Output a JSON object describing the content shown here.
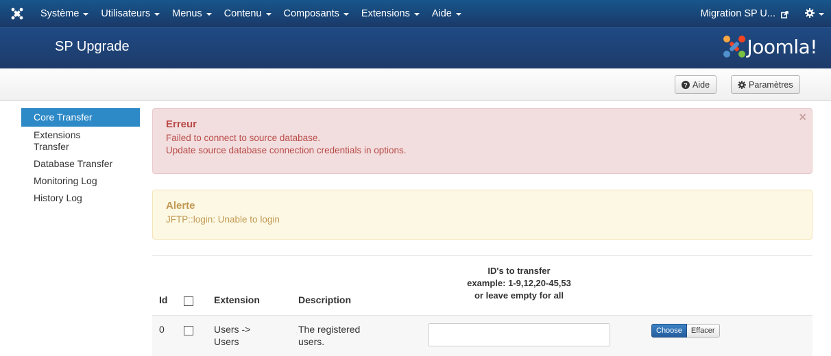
{
  "navbar": {
    "menus": [
      {
        "label": "Système"
      },
      {
        "label": "Utilisateurs"
      },
      {
        "label": "Menus"
      },
      {
        "label": "Contenu"
      },
      {
        "label": "Composants"
      },
      {
        "label": "Extensions"
      },
      {
        "label": "Aide"
      }
    ],
    "site_link": "Migration SP U..."
  },
  "header": {
    "title": "SP Upgrade",
    "brand": "Joomla!"
  },
  "toolbar": {
    "help_label": "Aide",
    "options_label": "Paramètres"
  },
  "sidebar": {
    "items": [
      {
        "label": "Core Transfer",
        "active": true
      },
      {
        "label": "Extensions Transfer"
      },
      {
        "label": "Database Transfer"
      },
      {
        "label": "Monitoring Log"
      },
      {
        "label": "History Log"
      }
    ]
  },
  "alerts": {
    "error": {
      "heading": "Erreur",
      "lines": [
        "Failed to connect to source database.",
        "Update source database connection credentials in options."
      ],
      "close": "×"
    },
    "warning": {
      "heading": "Alerte",
      "lines": [
        "JFTP::login: Unable to login"
      ]
    }
  },
  "table": {
    "headers": {
      "id": "Id",
      "extension": "Extension",
      "description": "Description",
      "ids_line1": "ID's to transfer",
      "ids_line2": "example: 1-9,12,20-45,53",
      "ids_line3": "or leave empty for all"
    },
    "rows": [
      {
        "id": "0",
        "extension_line1": "Users ->",
        "extension_line2": "Users",
        "description_line1": "The registered",
        "description_line2": "users.",
        "ids_value": "",
        "choose_label": "Choose",
        "clear_label": "Effacer"
      }
    ]
  },
  "colors": {
    "navbar": "#17568c",
    "header": "#1d3b69",
    "sidebar_active": "#2d8ac7",
    "error_bg": "#f2dede",
    "error_text": "#b94a48",
    "warning_bg": "#fcf8e3",
    "warning_text": "#c09853"
  }
}
